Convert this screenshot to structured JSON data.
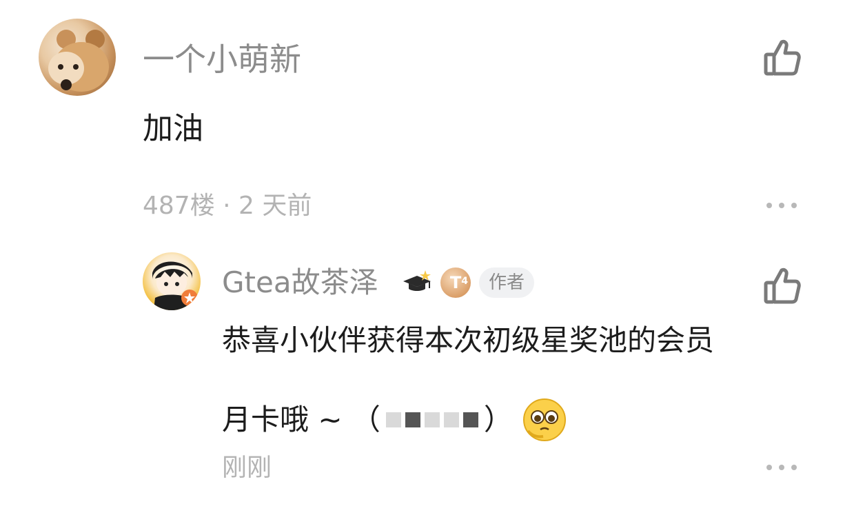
{
  "comments": [
    {
      "username": "一个小萌新",
      "content": "加油",
      "meta": "487楼 · 2 天前"
    }
  ],
  "reply": {
    "username": "Gtea故茶泽",
    "level_badge": "T",
    "level_sub": "4",
    "author_tag": "作者",
    "content_line1": "恭喜小伙伴获得本次初级星奖池的会员",
    "content_line2": "月卡哦 ~ （",
    "content_line2_end": "）",
    "meta": "刚刚"
  },
  "icons": {
    "like": "thumbs-up-icon",
    "more": "more-dots-icon",
    "grad_cap": "graduation-cap-icon",
    "emoji": "pleading-face-emoji"
  },
  "colors": {
    "username": "#8c8c8c",
    "content": "#1c1c1c",
    "meta": "#b3b3b3",
    "tag_bg": "#f0f1f3"
  }
}
